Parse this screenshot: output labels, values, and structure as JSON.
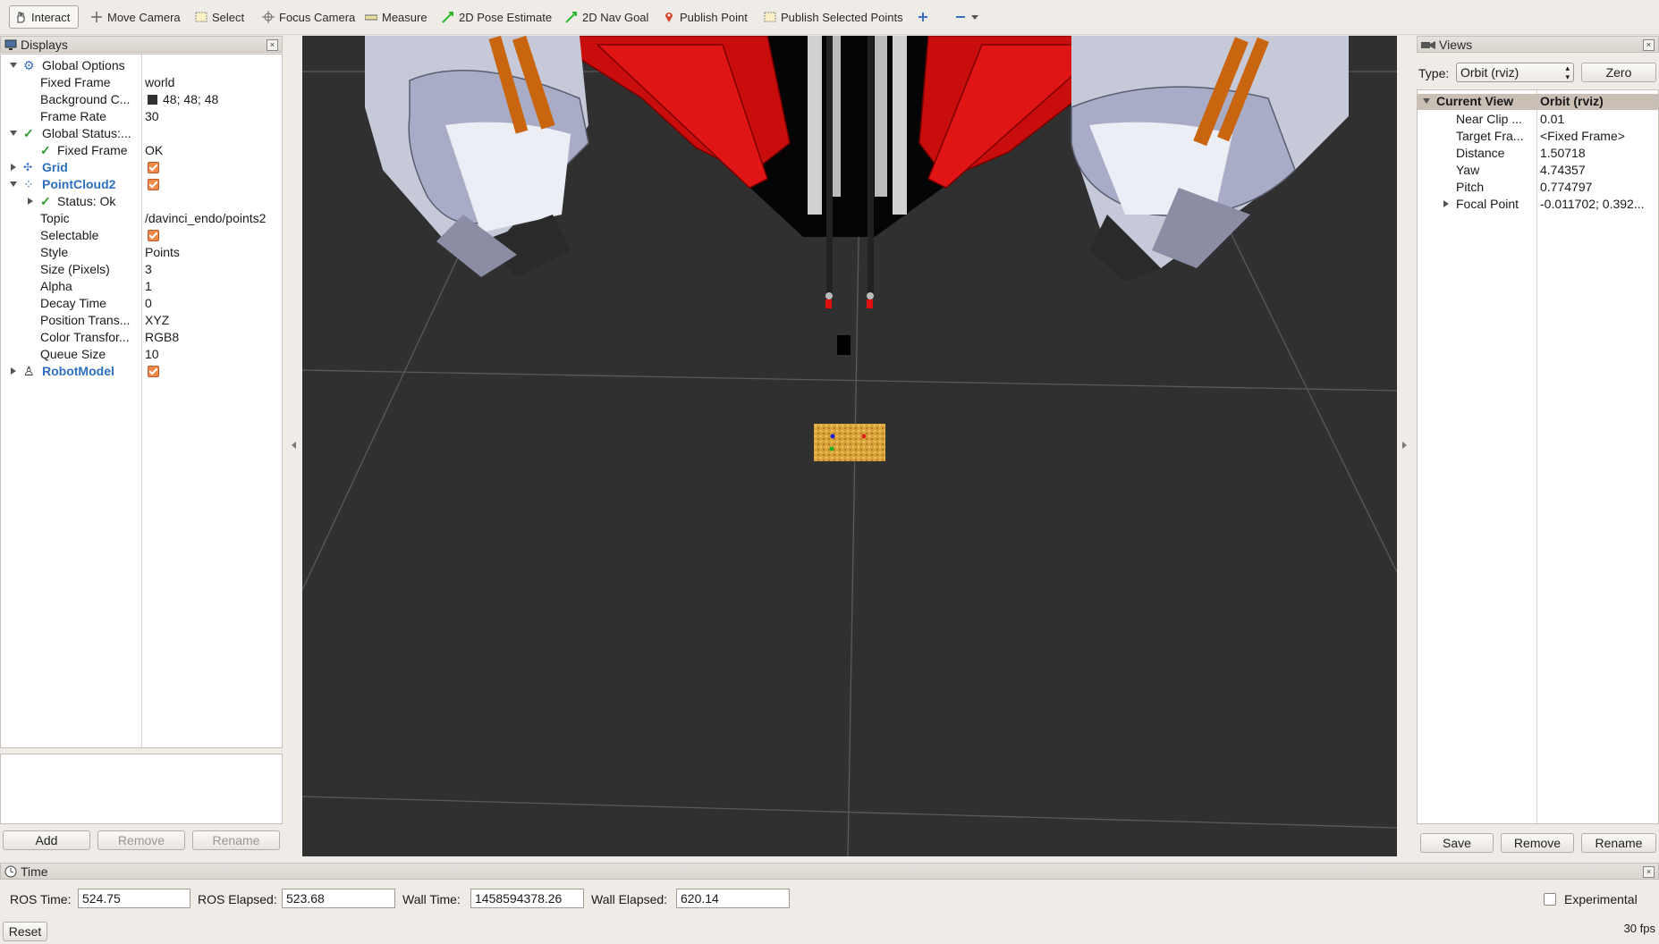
{
  "toolbar": {
    "items": [
      "Interact",
      "Move Camera",
      "Select",
      "Focus Camera",
      "Measure",
      "2D Pose Estimate",
      "2D Nav Goal",
      "Publish Point",
      "Publish Selected Points"
    ]
  },
  "displays": {
    "title": "Displays",
    "rows": [
      {
        "name": "Global Options",
        "value": ""
      },
      {
        "name": "Fixed Frame",
        "value": "world"
      },
      {
        "name": "Background C...",
        "value": "48; 48; 48"
      },
      {
        "name": "Frame Rate",
        "value": "30"
      },
      {
        "name": "Global Status:...",
        "value": ""
      },
      {
        "name": "Fixed Frame",
        "value": "OK"
      },
      {
        "name": "Grid",
        "value": ""
      },
      {
        "name": "PointCloud2",
        "value": ""
      },
      {
        "name": "Status: Ok",
        "value": ""
      },
      {
        "name": "Topic",
        "value": "/davinci_endo/points2"
      },
      {
        "name": "Selectable",
        "value": ""
      },
      {
        "name": "Style",
        "value": "Points"
      },
      {
        "name": "Size (Pixels)",
        "value": "3"
      },
      {
        "name": "Alpha",
        "value": "1"
      },
      {
        "name": "Decay Time",
        "value": "0"
      },
      {
        "name": "Position Trans...",
        "value": "XYZ"
      },
      {
        "name": "Color Transfor...",
        "value": "RGB8"
      },
      {
        "name": "Queue Size",
        "value": "10"
      },
      {
        "name": "RobotModel",
        "value": ""
      }
    ],
    "buttons": {
      "add": "Add",
      "remove": "Remove",
      "rename": "Rename"
    }
  },
  "views": {
    "title": "Views",
    "type_label": "Type:",
    "type_value": "Orbit (rviz)",
    "zero_label": "Zero",
    "header": {
      "col1": "Current View",
      "col2": "Orbit (rviz)"
    },
    "rows": [
      {
        "name": "Near Clip ...",
        "value": "0.01"
      },
      {
        "name": "Target Fra...",
        "value": "<Fixed Frame>"
      },
      {
        "name": "Distance",
        "value": "1.50718"
      },
      {
        "name": "Yaw",
        "value": "4.74357"
      },
      {
        "name": "Pitch",
        "value": "0.774797"
      },
      {
        "name": "Focal Point",
        "value": "-0.011702; 0.392..."
      }
    ],
    "buttons": {
      "save": "Save",
      "remove": "Remove",
      "rename": "Rename"
    }
  },
  "time": {
    "title": "Time",
    "ros_time_label": "ROS Time:",
    "ros_time": "524.75",
    "ros_elapsed_label": "ROS Elapsed:",
    "ros_elapsed": "523.68",
    "wall_time_label": "Wall Time:",
    "wall_time": "1458594378.26",
    "wall_elapsed_label": "Wall Elapsed:",
    "wall_elapsed": "620.14",
    "experimental_label": "Experimental",
    "reset_label": "Reset",
    "fps": "30 fps"
  },
  "colors": {
    "background": "#303030",
    "robot_red": "#d10f0f",
    "instrument_orange": "#c8650e",
    "mesh": "#a8acc6"
  }
}
